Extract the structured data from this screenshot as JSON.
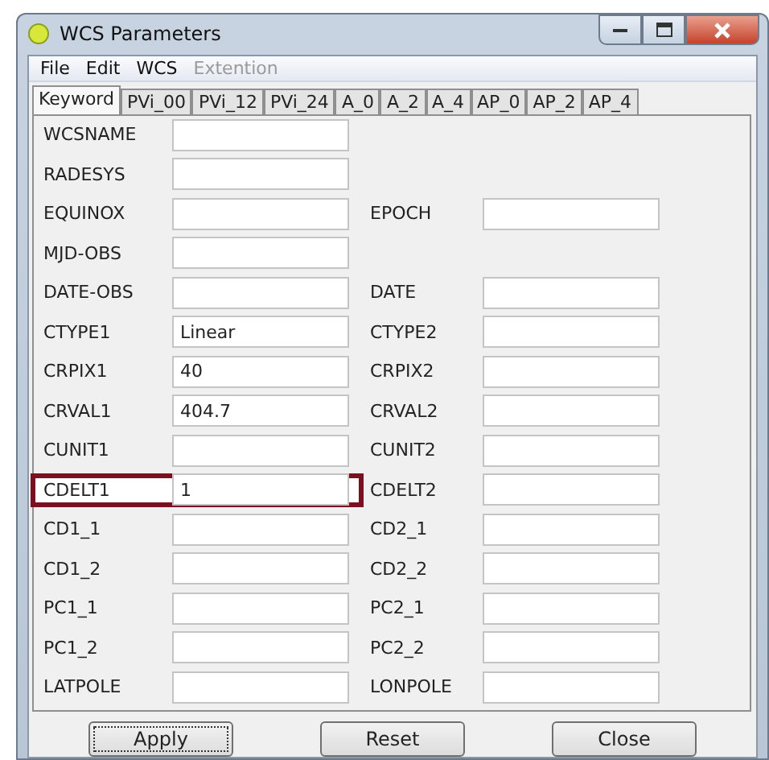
{
  "window": {
    "title": "WCS Parameters"
  },
  "menu": [
    {
      "label": "File",
      "disabled": false
    },
    {
      "label": "Edit",
      "disabled": false
    },
    {
      "label": "WCS",
      "disabled": false
    },
    {
      "label": "Extention",
      "disabled": true
    }
  ],
  "tabs": [
    {
      "label": "Keyword",
      "selected": true
    },
    {
      "label": "PVi_00",
      "selected": false
    },
    {
      "label": "PVi_12",
      "selected": false
    },
    {
      "label": "PVi_24",
      "selected": false
    },
    {
      "label": "A_0",
      "selected": false
    },
    {
      "label": "A_2",
      "selected": false
    },
    {
      "label": "A_4",
      "selected": false
    },
    {
      "label": "AP_0",
      "selected": false
    },
    {
      "label": "AP_2",
      "selected": false
    },
    {
      "label": "AP_4",
      "selected": false
    }
  ],
  "rows": [
    {
      "left": {
        "label": "WCSNAME",
        "highlighted": false
      }
    },
    {
      "left": {
        "label": "RADESYS",
        "highlighted": false
      }
    },
    {
      "left": {
        "label": "EQUINOX",
        "highlighted": false
      },
      "right": {
        "label": "EPOCH"
      }
    },
    {
      "left": {
        "label": "MJD-OBS",
        "highlighted": false
      }
    },
    {
      "left": {
        "label": "DATE-OBS",
        "highlighted": false
      },
      "right": {
        "label": "DATE"
      }
    },
    {
      "left": {
        "label": "CTYPE1",
        "value": "Linear",
        "highlighted": false
      },
      "right": {
        "label": "CTYPE2"
      }
    },
    {
      "left": {
        "label": "CRPIX1",
        "value": "40",
        "highlighted": false
      },
      "right": {
        "label": "CRPIX2"
      }
    },
    {
      "left": {
        "label": "CRVAL1",
        "value": "404.7",
        "highlighted": false
      },
      "right": {
        "label": "CRVAL2"
      }
    },
    {
      "left": {
        "label": "CUNIT1",
        "highlighted": false
      },
      "right": {
        "label": "CUNIT2"
      }
    },
    {
      "left": {
        "label": "CDELT1",
        "value": "1",
        "highlighted": true
      },
      "right": {
        "label": "CDELT2"
      }
    },
    {
      "left": {
        "label": "CD1_1",
        "highlighted": false
      },
      "right": {
        "label": "CD2_1"
      }
    },
    {
      "left": {
        "label": "CD1_2",
        "highlighted": false
      },
      "right": {
        "label": "CD2_2"
      }
    },
    {
      "left": {
        "label": "PC1_1",
        "highlighted": false
      },
      "right": {
        "label": "PC2_1"
      }
    },
    {
      "left": {
        "label": "PC1_2",
        "highlighted": false
      },
      "right": {
        "label": "PC2_2"
      }
    },
    {
      "left": {
        "label": "LATPOLE",
        "highlighted": false
      },
      "right": {
        "label": "LONPOLE"
      }
    }
  ],
  "buttons": [
    {
      "label": "Apply",
      "focused": true
    },
    {
      "label": "Reset",
      "focused": false
    },
    {
      "label": "Close",
      "focused": false
    }
  ]
}
